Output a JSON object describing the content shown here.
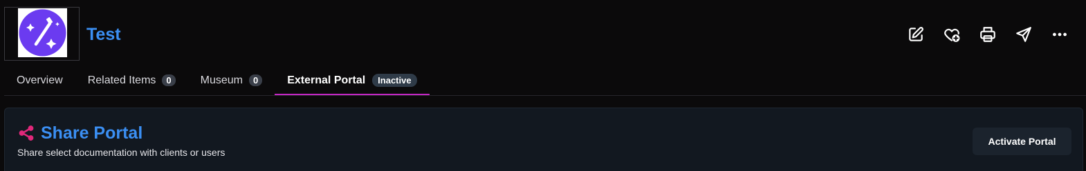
{
  "header": {
    "title": "Test",
    "logo_icon": "magic-wand-icon",
    "logo_color": "#6b3bf0",
    "actions": [
      {
        "icon": "edit-icon"
      },
      {
        "icon": "favorite-add-icon"
      },
      {
        "icon": "print-icon"
      },
      {
        "icon": "send-icon"
      },
      {
        "icon": "more-options-icon"
      }
    ]
  },
  "tabs": [
    {
      "label": "Overview"
    },
    {
      "label": "Related Items",
      "count": "0"
    },
    {
      "label": "Museum",
      "count": "0"
    },
    {
      "label": "External Portal",
      "status": "Inactive",
      "active": true
    }
  ],
  "card": {
    "icon": "share-icon",
    "icon_color": "#e0287a",
    "title": "Share Portal",
    "subtitle": "Share select documentation with clients or users",
    "button_label": "Activate Portal"
  },
  "colors": {
    "accent": "#3b8ff3",
    "active_tab_underline": "#c227c2",
    "background": "#0b0a0b"
  }
}
